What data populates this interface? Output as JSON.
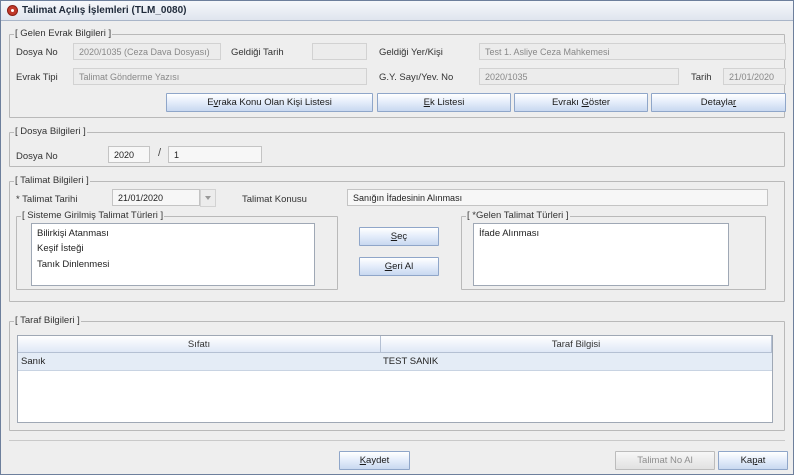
{
  "window": {
    "title": "Talimat Açılış İşlemleri (TLM_0080)"
  },
  "gelen_evrak": {
    "group_title": "[ Gelen Evrak Bilgileri ]",
    "dosya_no_label": "Dosya No",
    "dosya_no_value": "2020/1035 (Ceza Dava Dosyası)",
    "geldigi_tarih_label": "Geldiği Tarih",
    "geldigi_tarih_value": "",
    "geldigi_yer_label": "Geldiği Yer/Kişi",
    "geldigi_yer_value": "Test 1. Asliye Ceza Mahkemesi",
    "evrak_tipi_label": "Evrak Tipi",
    "evrak_tipi_value": "Talimat Gönderme Yazısı",
    "gy_sayi_label": "G.Y. Sayı/Yev. No",
    "gy_sayi_value": "2020/1035",
    "tarih_label": "Tarih",
    "tarih_value": "21/01/2020",
    "buttons": {
      "konu_olan_kisi": {
        "pre": "E",
        "ul": "v",
        "post": "raka Konu Olan Kişi Listesi"
      },
      "ek_listesi": {
        "pre": "",
        "ul": "E",
        "post": "k Listesi"
      },
      "evraki_goster": {
        "pre": "Evrakı ",
        "ul": "G",
        "post": "öster"
      },
      "detaylar": {
        "pre": "Detayla",
        "ul": "r",
        "post": ""
      }
    }
  },
  "dosya_bilgileri": {
    "group_title": "[ Dosya Bilgileri ]",
    "dosya_no_label": "Dosya No",
    "year_value": "2020",
    "separator": "/",
    "number_value": "1"
  },
  "talimat_bilgileri": {
    "group_title": "[ Talimat Bilgileri ]",
    "tarih_label": "* Talimat Tarihi",
    "tarih_value": "21/01/2020",
    "konusu_label": "Talimat Konusu",
    "konusu_value": "Sanığın İfadesinin Alınması",
    "sistem_turleri_title": "[ Sisteme Girilmiş Talimat Türleri ]",
    "sistem_turleri": [
      "Bilirkişi Atanması",
      "Keşif İsteği",
      "Tanık Dinlenmesi"
    ],
    "gelen_turleri_title": "[ *Gelen Talimat Türleri ]",
    "gelen_turleri": [
      "İfade Alınması"
    ],
    "sec_button": {
      "pre": "",
      "ul": "S",
      "post": "eç"
    },
    "geri_al_button": {
      "pre": "",
      "ul": "G",
      "post": "eri Al"
    }
  },
  "taraf_bilgileri": {
    "group_title": "[ Taraf Bilgileri ]",
    "columns": [
      "Sıfatı",
      "Taraf Bilgisi"
    ],
    "rows": [
      {
        "sifati": "Sanık",
        "taraf_bilgisi": "TEST SANIK"
      }
    ]
  },
  "footer": {
    "kaydet": {
      "pre": "",
      "ul": "K",
      "post": "aydet"
    },
    "talimat_no_al": "Talimat No Al",
    "kapat": {
      "pre": "Ka",
      "ul": "p",
      "post": "at"
    }
  }
}
